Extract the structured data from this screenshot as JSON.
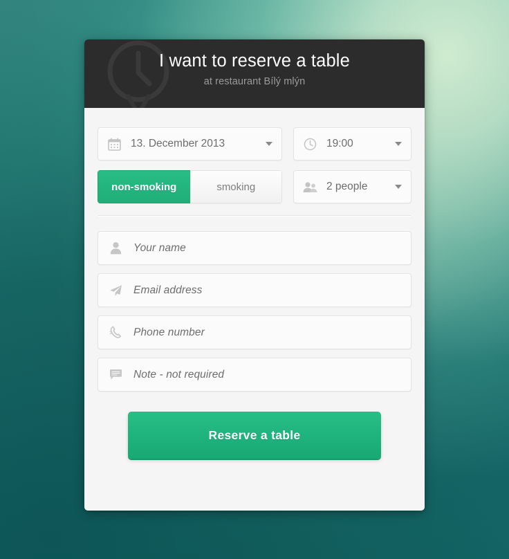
{
  "header": {
    "title": "I want to reserve a table",
    "subtitle": "at restaurant Bílý mlýn",
    "background_color": "#2c2c2c",
    "watermark_icon": "clock-icon"
  },
  "booking": {
    "date": {
      "icon": "calendar-icon",
      "value": "13. December 2013"
    },
    "time": {
      "icon": "clock-icon",
      "value": "19:00"
    },
    "people": {
      "icon": "people-group-icon",
      "value": "2 people"
    },
    "smoking_toggle": {
      "options": [
        "non-smoking",
        "smoking"
      ],
      "selected": "non-smoking"
    }
  },
  "contact": {
    "name": {
      "icon": "person-icon",
      "placeholder": "Your name",
      "value": ""
    },
    "email": {
      "icon": "paper-plane-icon",
      "placeholder": "Email address",
      "value": ""
    },
    "phone": {
      "icon": "phone-icon",
      "placeholder": "Phone number",
      "value": ""
    },
    "note": {
      "icon": "comment-icon",
      "placeholder": "Note - not required",
      "value": ""
    }
  },
  "submit": {
    "label": "Reserve a table"
  },
  "colors": {
    "accent_green": "#1fae77",
    "header_dark": "#2c2c2c",
    "card_background": "#f5f5f5",
    "placeholder_gray": "#b4b4b4",
    "backdrop_teal": "#2b8079",
    "backdrop_mint": "#bce2c8"
  }
}
